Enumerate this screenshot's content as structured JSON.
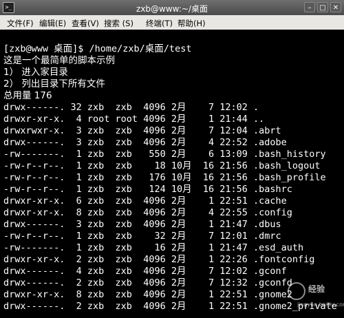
{
  "window": {
    "title": "zxb@www:~/桌面"
  },
  "menu": [
    "文件(F)",
    "编辑(E)",
    "查看(V)",
    "搜索 (S)",
    "终端(T)",
    "帮助(H)"
  ],
  "terminal": {
    "lines": [
      "[zxb@www 桌面]$ /home/zxb/桌面/test",
      "这是一个最简单的脚本示例",
      "1） 进入家目录",
      "2） 列出目录下所有文件",
      "总用量 176",
      "drwx------. 32 zxb  zxb  4096 2月    7 12:02 .",
      "drwxr-xr-x.  4 root root 4096 2月    1 21:44 ..",
      "drwxrwxr-x.  3 zxb  zxb  4096 2月    7 12:04 .abrt",
      "drwx------.  3 zxb  zxb  4096 2月    4 22:52 .adobe",
      "-rw-------.  1 zxb  zxb   550 2月    6 13:09 .bash_history",
      "-rw-r--r--.  1 zxb  zxb    18 10月  16 21:56 .bash_logout",
      "-rw-r--r--.  1 zxb  zxb   176 10月  16 21:56 .bash_profile",
      "-rw-r--r--.  1 zxb  zxb   124 10月  16 21:56 .bashrc",
      "drwxr-xr-x.  6 zxb  zxb  4096 2月    1 22:51 .cache",
      "drwxr-xr-x.  8 zxb  zxb  4096 2月    4 22:55 .config",
      "drwx------.  3 zxb  zxb  4096 2月    1 21:47 .dbus",
      "-rw-r--r--.  1 zxb  zxb    32 2月    7 12:01 .dmrc",
      "-rw-------.  1 zxb  zxb    16 2月    1 21:47 .esd_auth",
      "drwxr-xr-x.  2 zxb  zxb  4096 2月    1 22:26 .fontconfig",
      "drwx------.  4 zxb  zxb  4096 2月    7 12:02 .gconf",
      "drwx------.  2 zxb  zxb  4096 2月    7 12:32 .gconfd",
      "drwxr-xr-x.  8 zxb  zxb  4096 2月    1 22:51 .gnome2",
      "drwx------.  2 zxb  zxb  4096 2月    1 22:51 .gnome2_private"
    ]
  },
  "watermark": {
    "brand": "经验",
    "url": "jingyan.baidu.com"
  }
}
